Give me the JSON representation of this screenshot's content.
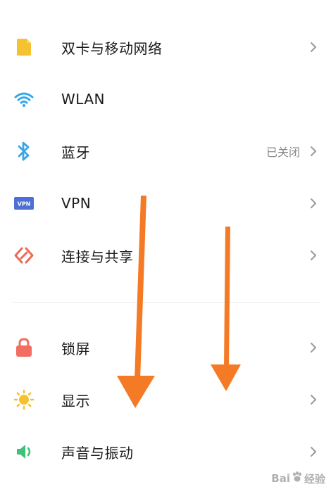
{
  "settings": {
    "items": [
      {
        "label": "双卡与移动网络",
        "status": "",
        "icon": "sim-card-icon"
      },
      {
        "label": "WLAN",
        "status": "",
        "icon": "wifi-icon"
      },
      {
        "label": "蓝牙",
        "status": "已关闭",
        "icon": "bluetooth-icon"
      },
      {
        "label": "VPN",
        "status": "",
        "icon": "vpn-icon",
        "icon_text": "VPN"
      },
      {
        "label": "连接与共享",
        "status": "",
        "icon": "connection-share-icon"
      },
      {
        "label": "锁屏",
        "status": "",
        "icon": "lock-icon"
      },
      {
        "label": "显示",
        "status": "",
        "icon": "sun-icon"
      },
      {
        "label": "声音与振动",
        "status": "",
        "icon": "speaker-icon"
      }
    ]
  },
  "colors": {
    "sim": "#f5c330",
    "wifi": "#35a8e8",
    "bluetooth": "#3ba6e6",
    "vpn": "#4d6fd6",
    "share": "#ec6a55",
    "lock": "#f26e60",
    "sun": "#f6c02e",
    "speaker": "#3ec27a",
    "annotation_arrow": "#f47a26",
    "chevron": "#9a9a9a"
  },
  "watermark": {
    "text_a": "Bai",
    "text_b": "经验"
  }
}
